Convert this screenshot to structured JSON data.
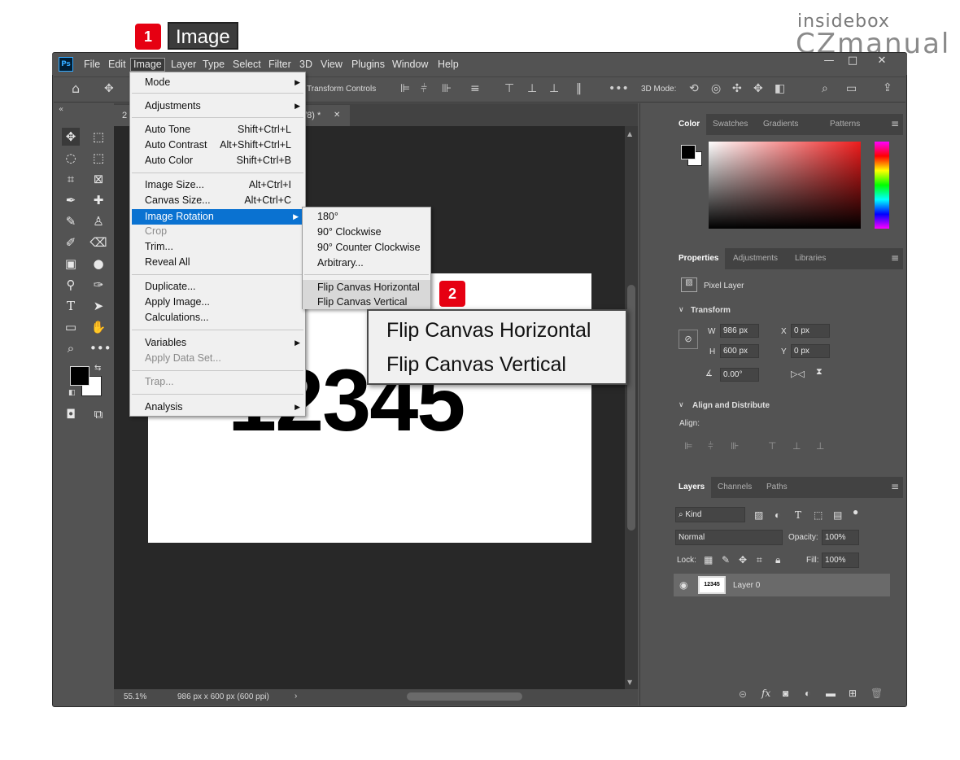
{
  "brand": {
    "line1": "insidebox",
    "line2": "ⅭZmanual"
  },
  "callouts": {
    "badge1": "1",
    "badge2": "2",
    "image_label": "Image"
  },
  "app": {
    "logo": "Ps"
  },
  "menubar": {
    "file": "File",
    "edit": "Edit",
    "image": "Image",
    "layer": "Layer",
    "type": "Type",
    "select": "Select",
    "filter": "Filter",
    "threeD": "3D",
    "view": "View",
    "plugins": "Plugins",
    "window": "Window",
    "help": "Help"
  },
  "window_controls": {
    "minimize": "—",
    "maximize": "□",
    "close": "✕"
  },
  "options_bar": {
    "transform_controls": "Transform Controls",
    "mode_3d": "3D Mode:"
  },
  "document": {
    "tab_fragment": "2",
    "tab_suffix": "3/8) *",
    "content": "12345"
  },
  "status": {
    "zoom": "55.1%",
    "info": "986 px x 600 px (600 ppi)"
  },
  "image_menu": {
    "mode": "Mode",
    "adjustments": "Adjustments",
    "auto_tone": "Auto Tone",
    "auto_tone_sc": "Shift+Ctrl+L",
    "auto_contrast": "Auto Contrast",
    "auto_contrast_sc": "Alt+Shift+Ctrl+L",
    "auto_color": "Auto Color",
    "auto_color_sc": "Shift+Ctrl+B",
    "image_size": "Image Size...",
    "image_size_sc": "Alt+Ctrl+I",
    "canvas_size": "Canvas Size...",
    "canvas_size_sc": "Alt+Ctrl+C",
    "image_rotation": "Image Rotation",
    "crop": "Crop",
    "trim": "Trim...",
    "reveal_all": "Reveal All",
    "duplicate": "Duplicate...",
    "apply_image": "Apply Image...",
    "calculations": "Calculations...",
    "variables": "Variables",
    "apply_data_set": "Apply Data Set...",
    "trap": "Trap...",
    "analysis": "Analysis"
  },
  "rotation_menu": {
    "r180": "180°",
    "cw90": "90° Clockwise",
    "ccw90": "90° Counter Clockwise",
    "arbitrary": "Arbitrary...",
    "flip_h": "Flip Canvas Horizontal",
    "flip_v": "Flip Canvas Vertical"
  },
  "zoom_callout": {
    "flip_h": "Flip Canvas Horizontal",
    "flip_v": "Flip Canvas Vertical"
  },
  "color_panel": {
    "tabs": [
      "Color",
      "Swatches",
      "Gradients",
      "Patterns"
    ]
  },
  "properties_panel": {
    "tabs": [
      "Properties",
      "Adjustments",
      "Libraries"
    ],
    "pixel_layer": "Pixel Layer",
    "transform": "Transform",
    "w_label": "W",
    "w_value": "986 px",
    "h_label": "H",
    "h_value": "600 px",
    "x_label": "X",
    "x_value": "0 px",
    "y_label": "Y",
    "y_value": "0 px",
    "angle_value": "0.00°",
    "align_distribute": "Align and Distribute",
    "align": "Align:"
  },
  "layers_panel": {
    "tabs": [
      "Layers",
      "Channels",
      "Paths"
    ],
    "kind": "Kind",
    "blend_mode": "Normal",
    "opacity_label": "Opacity:",
    "opacity": "100%",
    "lock_label": "Lock:",
    "fill_label": "Fill:",
    "fill": "100%",
    "layer_name": "Layer 0",
    "thumb_text": "12345"
  },
  "colors": {
    "highlight": "#0a72d1",
    "badge": "#e60012",
    "ps_blue": "#31a8ff"
  }
}
